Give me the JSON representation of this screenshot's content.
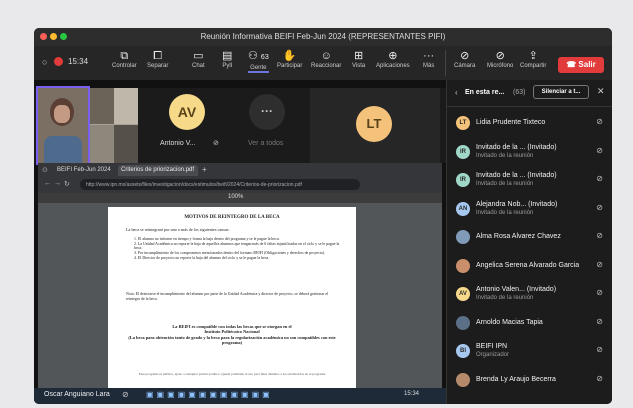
{
  "window": {
    "title": "Reunión Informativa BEIFI Feb-Jun 2024 (REPRESENTANTES PIFI)"
  },
  "toolbar": {
    "time": "15:34",
    "items": [
      {
        "label": "Controlar",
        "icon": "remote-control-icon"
      },
      {
        "label": "Separar",
        "icon": "pop-out-icon"
      },
      {
        "label": "Chat",
        "icon": "chat-icon"
      },
      {
        "label": "Pyll",
        "icon": "poll-icon"
      },
      {
        "label": "Gente",
        "icon": "people-icon",
        "count": "63"
      },
      {
        "label": "Participar",
        "icon": "raise-hand-icon"
      },
      {
        "label": "Reaccionar",
        "icon": "react-icon"
      },
      {
        "label": "Vista",
        "icon": "view-icon"
      },
      {
        "label": "Aplicaciones",
        "icon": "apps-icon"
      },
      {
        "label": "Más",
        "icon": "more-icon"
      },
      {
        "label": "Cámara",
        "icon": "camera-off-icon"
      },
      {
        "label": "Micrófono",
        "icon": "mic-off-icon"
      },
      {
        "label": "Compartir",
        "icon": "share-icon"
      }
    ],
    "leave_label": "Salir"
  },
  "strip": {
    "tile_av": {
      "initials": "AV",
      "name": "Antonio V..."
    },
    "tile_more": {
      "label": "Ver a todos"
    },
    "tile_lt": {
      "initials": "LT"
    }
  },
  "browser": {
    "tab1": "BEIFI Feb-Jun 2024",
    "tab2": "Criterios de priorizacion.pdf",
    "url": "http://www.ipn.mx/assets/files/investigacion/docs/estimulos/beifi/2024/Criterios-de-priorizacion.pdf",
    "zoom": "100%"
  },
  "pdf": {
    "heading": "MOTIVOS DE REINTEGRO DE LA BECA",
    "intro": "La beca se reintegrará por uno o más de los siguientes causas:",
    "items": [
      "1. El alumno no informe en tiempo y forma la baja dentro del programa y se le pague la beca.",
      "2. La Unidad Académica no reporte la baja de aquellos alumnos que tengan más de 6 faltas injustificadas en el ciclo y se le pague la beca.",
      "3. Por incumplimiento de los compromisos mencionados dentro del formato BEIFI (Obligaciones y derechos de proyecto).",
      "4. El Director de proyecto no reporte la baja del alumno del ciclo y se le pague la beca."
    ],
    "nota": "Nota: El detectarse el incumplimiento del alumno por parte de la Unidad Académica y director de proyecto, se deberá gestionar el reintegro de la beca.",
    "bold1": "La BEIFI es compatible con todas las becas que se otorgan en el",
    "bold2": "Instituto Politécnico Nacional",
    "bold3": "(La beca para obtención tanto de grado y la beca para la regularización académica no son compatibles con este programa)",
    "footer": "Este programa es público, ajeno a cualquier partido político. Queda prohibido el uso para fines distintos a los establecidos en el programa"
  },
  "taskbar": {
    "user": "Oscar Anguiano Lara",
    "time": "15:34"
  },
  "panel": {
    "title": "En esta re...",
    "count": "(63)",
    "mute_all": "Silenciar a t...",
    "participants": [
      {
        "initials": "LT",
        "name": "Lidia Prudente Tixteco",
        "sub": "",
        "color": "#f4c27a"
      },
      {
        "initials": "IR",
        "name": "Invitado de la ... (Invitado)",
        "sub": "Invitado de la reunión",
        "color": "#9fd8c9"
      },
      {
        "initials": "IR",
        "name": "Invitado de la ... (Invitado)",
        "sub": "Invitado de la reunión",
        "color": "#9fd8c9"
      },
      {
        "initials": "AN",
        "name": "Alejandra Nob... (Invitado)",
        "sub": "Invitado de la reunión",
        "color": "#a6c8f0"
      },
      {
        "initials": "",
        "name": "Alma Rosa Alvarez Chavez",
        "sub": "",
        "color": "#7f9bb8"
      },
      {
        "initials": "",
        "name": "Angelica Serena Alvarado Garcia",
        "sub": "",
        "color": "#c98f6b"
      },
      {
        "initials": "AV",
        "name": "Antonio Valen... (Invitado)",
        "sub": "Invitado de la reunión",
        "color": "#f7d98a"
      },
      {
        "initials": "",
        "name": "Arnoldo Macias Tapia",
        "sub": "",
        "color": "#5b6f86"
      },
      {
        "initials": "BI",
        "name": "BEIFI IPN",
        "sub": "Organizador",
        "color": "#a6c8f0"
      },
      {
        "initials": "",
        "name": "Brenda Ly Araujo Becerra",
        "sub": "",
        "color": "#b58a6b"
      }
    ]
  }
}
